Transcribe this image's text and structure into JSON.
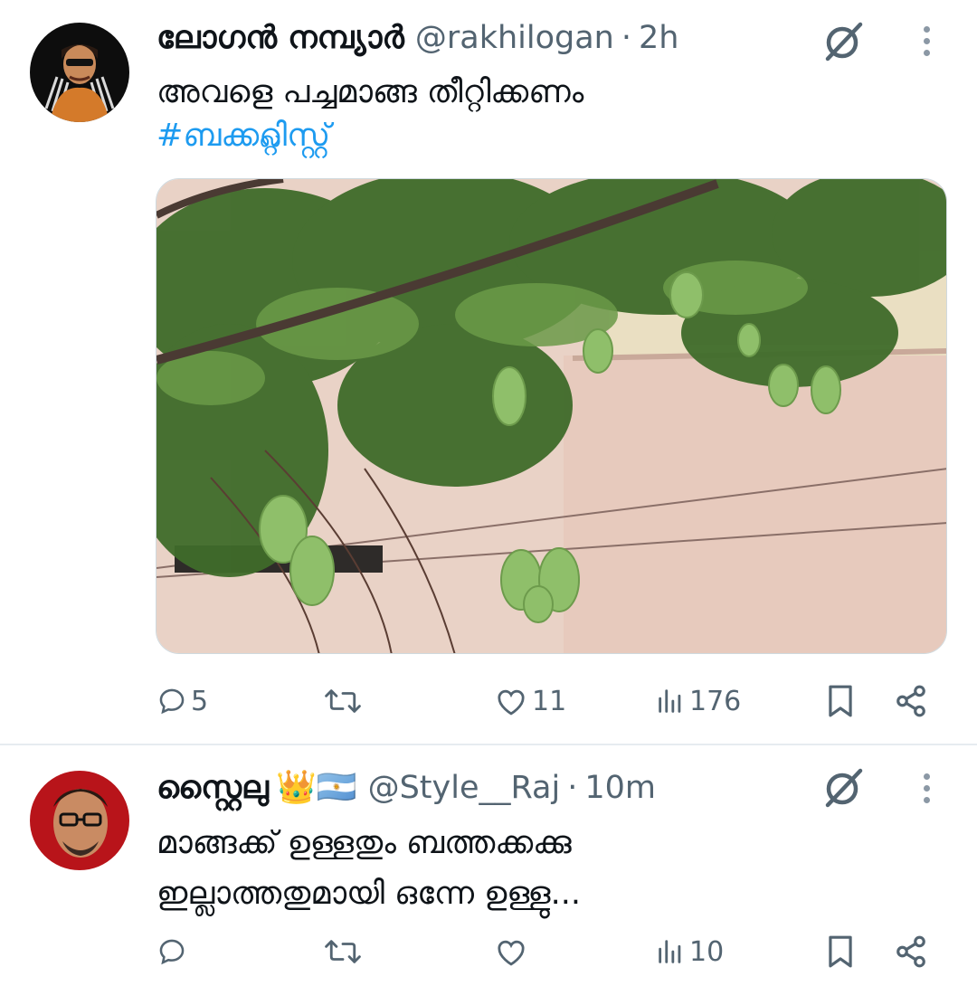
{
  "tweets": [
    {
      "author": {
        "name": "ലോഗൻ നമ്പ്യാർ",
        "handle": "@rakhilogan",
        "time": "2h"
      },
      "text": "അവളെ പച്ചമാങ്ങ തീറ്റിക്കണം",
      "hashtag": "#ബക്കറ്റ്ലിസ്റ്റ്",
      "media": {
        "description_icon": "mango-tree-photo"
      },
      "actions": {
        "replies": "5",
        "retweets": "",
        "likes": "11",
        "views": "176"
      }
    },
    {
      "author": {
        "name": "സ്റ്റൈലു",
        "badges": "👑🇦🇷",
        "handle": "@Style__Raj",
        "time": "10m"
      },
      "text_line1": "മാങ്ങക്ക് ഉള്ളതും ബത്തക്കക്കു",
      "text_line2": "ഇല്ലാത്തതുമായി ഒന്നേ ഉള്ളു...",
      "actions": {
        "replies": "",
        "retweets": "",
        "likes": "",
        "views": "10"
      }
    }
  ],
  "colors": {
    "text": "#0f1419",
    "muted": "#536471",
    "link": "#1d9bf0",
    "divider": "#e6ecf0"
  }
}
